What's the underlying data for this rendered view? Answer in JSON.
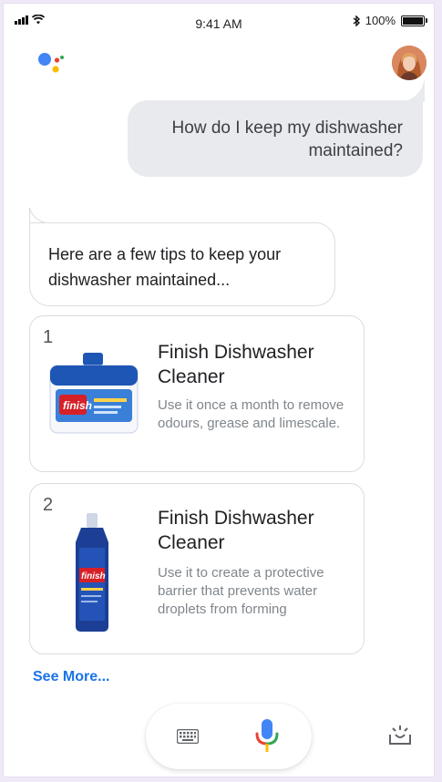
{
  "status_bar": {
    "time": "9:41 AM",
    "battery_text": "100%",
    "battery_level": 1.0,
    "icons": [
      "signal-icon",
      "wifi-icon",
      "bluetooth-icon",
      "battery-icon"
    ]
  },
  "header": {
    "logo_icon": "google-assistant-logo",
    "avatar_icon": "user-avatar"
  },
  "conversation": {
    "user_message": "How do I keep my dishwasher maintained?",
    "assistant_message": "Here are a few tips to keep your dishwasher maintained..."
  },
  "cards": [
    {
      "number": "1",
      "title": "Finish Dishwasher Cleaner",
      "description": "Use it once a month to remove odours, grease and limescale.",
      "image_icon": "dishwasher-cleaner-bottle-image"
    },
    {
      "number": "2",
      "title": "Finish Dishwasher Cleaner",
      "description": "Use it to create a protective barrier that prevents water droplets from forming",
      "image_icon": "rinse-aid-bottle-image"
    }
  ],
  "see_more_label": "See More...",
  "bottom_bar": {
    "keyboard_icon": "keyboard-icon",
    "mic_icon": "microphone-icon",
    "explore_icon": "explore-tray-icon"
  },
  "colors": {
    "accent_blue": "#1a73e8",
    "google_blue": "#4285f4",
    "google_red": "#ea4335",
    "google_yellow": "#fbbc04",
    "google_green": "#34a853",
    "user_bubble_bg": "#e8eaed"
  }
}
